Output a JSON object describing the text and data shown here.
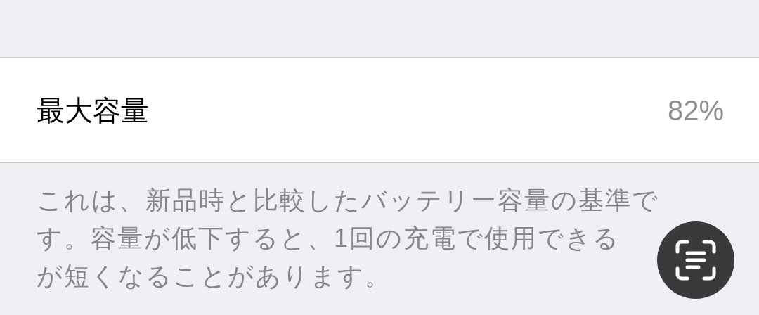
{
  "row": {
    "label": "最大容量",
    "value": "82%"
  },
  "footer": {
    "lines": [
      "これは、新品時と比較したバッテリー容量の基準で",
      "す。容量が低下すると、1回の充電で使用できる",
      "が短くなることがあります。"
    ]
  },
  "overlay_button": {
    "kind": "text-scan"
  }
}
